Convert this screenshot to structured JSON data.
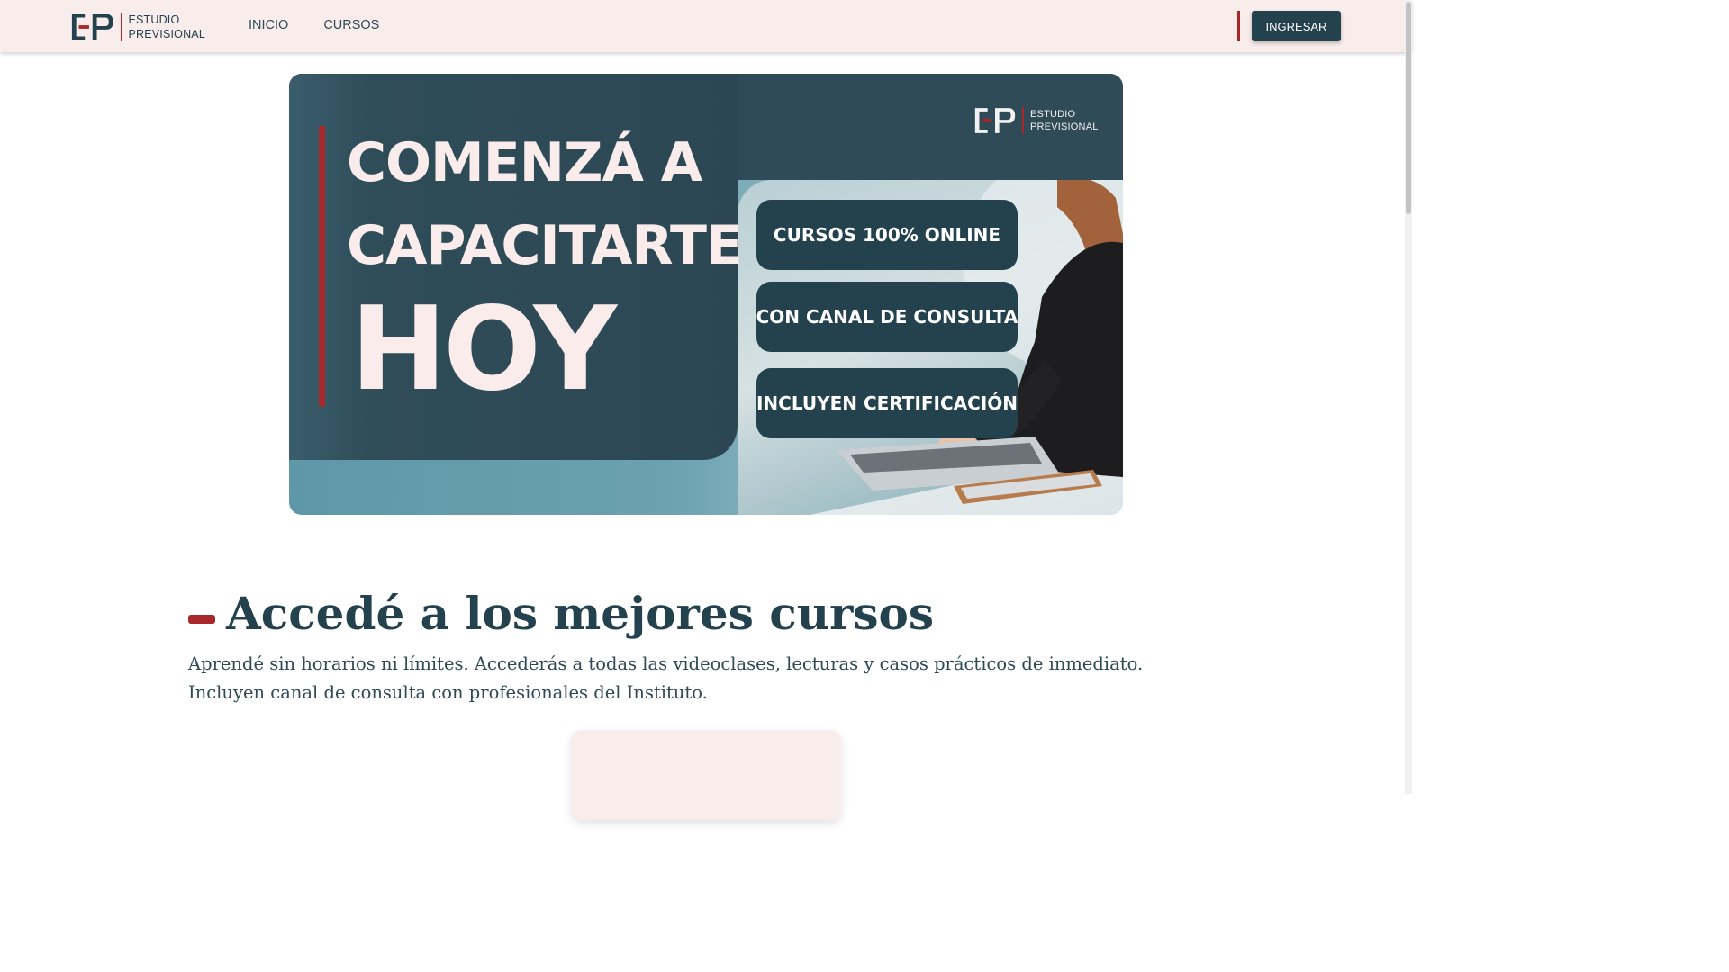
{
  "header": {
    "logo": {
      "line1": "ESTUDIO",
      "line2": "PREVISIONAL"
    },
    "nav": [
      {
        "label": "INICIO"
      },
      {
        "label": "CURSOS"
      }
    ],
    "login_label": "INGRESAR"
  },
  "hero": {
    "line1": "COMENZÁ A",
    "line2": "CAPACITARTE",
    "line3": "HOY",
    "logo": {
      "line1": "ESTUDIO",
      "line2": "PREVISIONAL"
    },
    "features": [
      {
        "label": "CURSOS 100% ONLINE"
      },
      {
        "label": "CON CANAL DE CONSULTA"
      },
      {
        "label": "INCLUYEN CERTIFICACIÓN"
      }
    ]
  },
  "section": {
    "title": "Accedé a los mejores cursos",
    "text_line1": "Aprendé sin horarios ni límites. Accederás a todas las videoclases, lecturas y casos prácticos de inmediato.",
    "text_line2": "Incluyen canal de consulta con profesionales del Instituto."
  },
  "colors": {
    "primary": "#24414e",
    "accent": "#a8282a",
    "header_bg": "#f9edeb",
    "hero_text": "#f9ecea"
  },
  "icons": {
    "logo": "ep-logo-mark",
    "hero_photo": "woman-typing-laptop-photo"
  }
}
